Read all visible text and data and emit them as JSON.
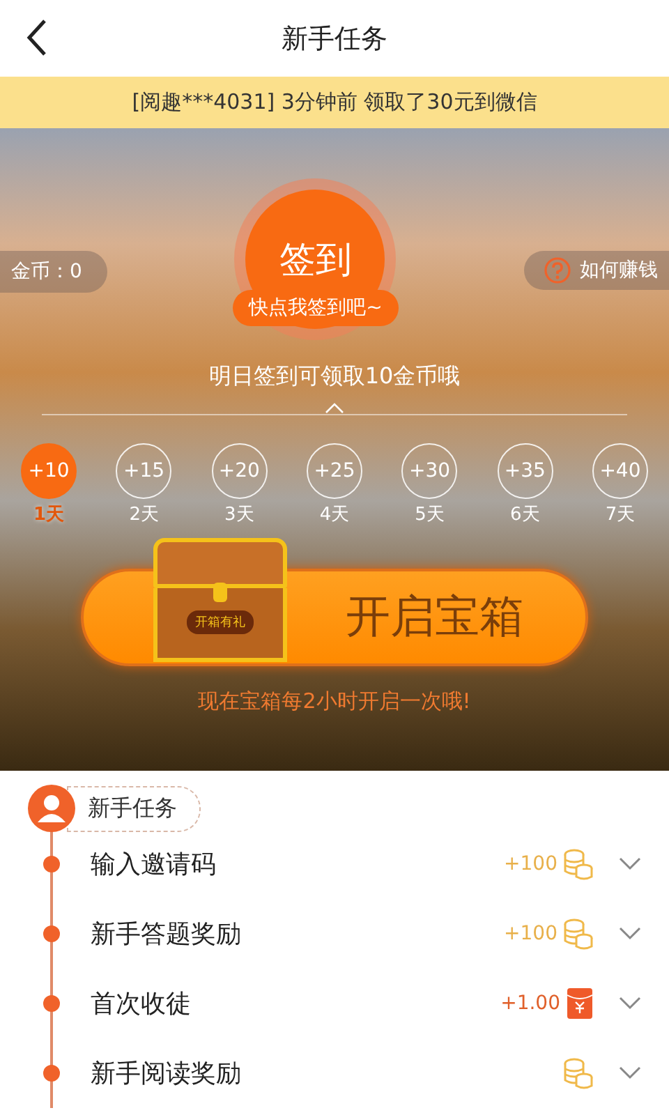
{
  "header": {
    "title": "新手任务"
  },
  "notice": "[阅趣***4031] 3分钟前 领取了30元到微信",
  "hero": {
    "coins": "金币：0",
    "help": "如何赚钱",
    "sign_button": "签到",
    "sign_tip": "快点我签到吧~",
    "tomorrow": "明日签到可领取10金币哦",
    "days": [
      {
        "reward": "+10",
        "label": "1天",
        "selected": true
      },
      {
        "reward": "+15",
        "label": "2天",
        "selected": false
      },
      {
        "reward": "+20",
        "label": "3天",
        "selected": false
      },
      {
        "reward": "+25",
        "label": "4天",
        "selected": false
      },
      {
        "reward": "+30",
        "label": "5天",
        "selected": false
      },
      {
        "reward": "+35",
        "label": "6天",
        "selected": false
      },
      {
        "reward": "+40",
        "label": "7天",
        "selected": false
      }
    ],
    "chest_tag": "开箱有礼",
    "chest_button": "开启宝箱",
    "chest_note": "现在宝箱每2小时开启一次哦!"
  },
  "tasks": {
    "title": "新手任务",
    "items": [
      {
        "name": "输入邀请码",
        "reward": "+100",
        "kind": "coin"
      },
      {
        "name": "新手答题奖励",
        "reward": "+100",
        "kind": "coin"
      },
      {
        "name": "首次收徒",
        "reward": "+1.00",
        "kind": "cash"
      },
      {
        "name": "新手阅读奖励",
        "kind": "coin"
      }
    ]
  }
}
